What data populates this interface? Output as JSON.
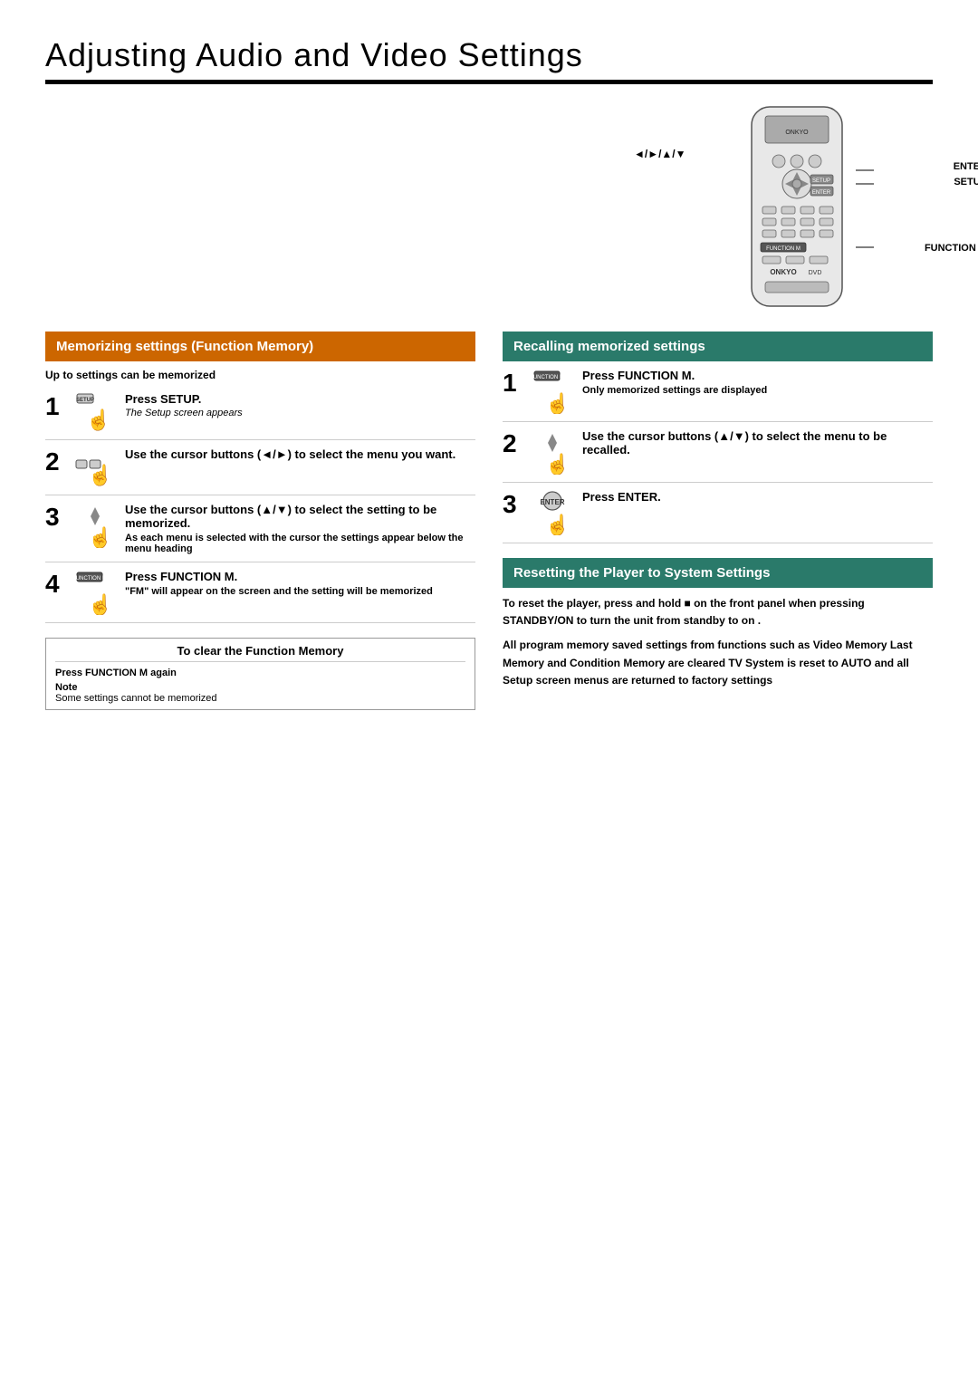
{
  "page": {
    "title": "Adjusting Audio and Video Settings"
  },
  "remote_labels": {
    "enter": "ENTER",
    "setup": "SETUP",
    "function_m": "FUNCTION M",
    "arrow": "◄/►/▲/▼"
  },
  "left_section": {
    "header": "Memorizing settings (Function Memory)",
    "up_to_label": "Up to    settings can be memorized",
    "steps": [
      {
        "number": "1",
        "icon_label": "SETUP",
        "title": "Press SETUP.",
        "sub": "The Setup screen appears"
      },
      {
        "number": "2",
        "icon_label": "◄►",
        "title": "Use the cursor buttons (◄/►) to select the menu you want.",
        "sub": ""
      },
      {
        "number": "3",
        "icon_label": "▲▼",
        "title": "Use the cursor buttons (▲/▼) to select the setting to be memorized.",
        "sub": "As each menu is selected with the cursor the settings appear below the menu heading"
      },
      {
        "number": "4",
        "icon_label": "FUNCTION M",
        "title": "Press FUNCTION M.",
        "sub": "\"FM\" will appear on the screen  and the setting will be memorized"
      }
    ],
    "clear_section": {
      "title": "To clear the Function Memory",
      "instruction": "Press FUNCTION M  again",
      "note_label": "Note",
      "note_text": "Some settings cannot be memorized"
    }
  },
  "right_section": {
    "recall_header": "Recalling memorized settings",
    "recall_steps": [
      {
        "number": "1",
        "icon_label": "FUNCTION M",
        "title": "Press FUNCTION M.",
        "sub": "Only memorized settings are displayed"
      },
      {
        "number": "2",
        "icon_label": "▲▼",
        "title": "Use the cursor buttons (▲/▼) to select the menu to be recalled.",
        "sub": ""
      },
      {
        "number": "3",
        "icon_label": "ENTER",
        "title": "Press ENTER.",
        "sub": ""
      }
    ],
    "reset_section": {
      "header": "Resetting the Player to System Settings",
      "text1": "To reset the player, press and hold ■ on the front panel when pressing STANDBY/ON to turn the unit from standby to on .",
      "text2": "All program memory  saved settings from functions such as Video Memory  Last Memory and Condition Memory are cleared  TV System is reset to AUTO and all Setup screen menus are returned to factory settings"
    }
  }
}
